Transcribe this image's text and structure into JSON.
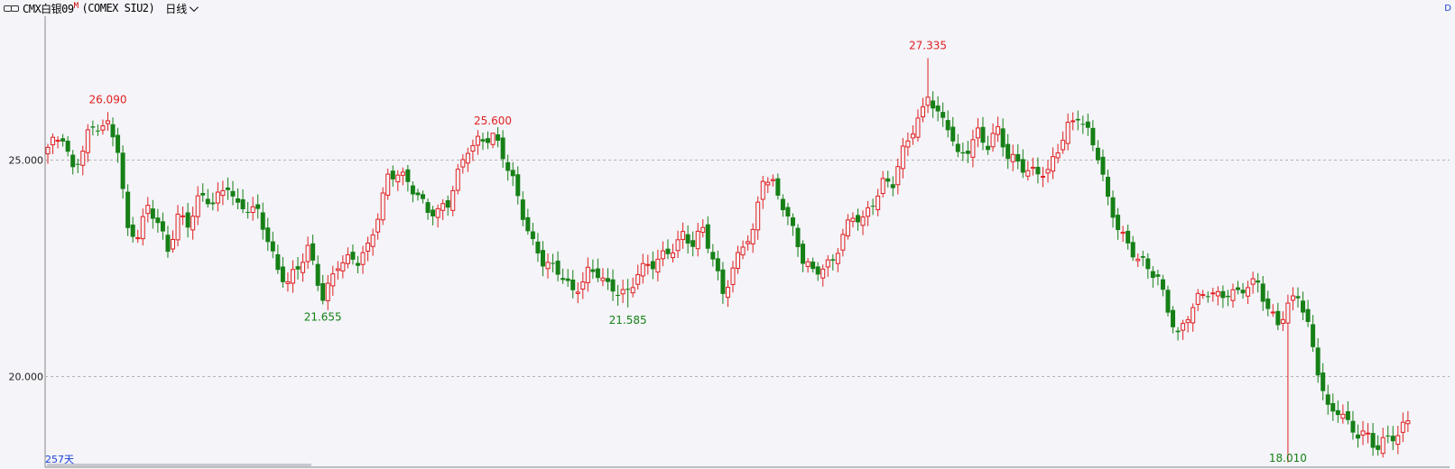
{
  "header": {
    "title": "CMX白银09",
    "title_sup": "M",
    "subtitle": "(COMEX SIU2)",
    "period": "日线",
    "right_mark": "D"
  },
  "footer": {
    "days": "257天"
  },
  "colors": {
    "up": "#e02020",
    "down": "#168016",
    "background": "#f4f4f9",
    "grid": "#bbbbbb"
  },
  "chart_data": {
    "type": "candlestick",
    "y_ticks": [
      {
        "value": 25,
        "label": "25.000"
      },
      {
        "value": 20,
        "label": "20.000"
      }
    ],
    "ylim": [
      17.9,
      28.3
    ],
    "grid": "horizontal-dashed",
    "extremes": [
      {
        "label": "26.090",
        "value": 26.09,
        "kind": "high",
        "index": 12
      },
      {
        "label": "21.655",
        "value": 21.655,
        "kind": "low",
        "index": 55
      },
      {
        "label": "25.600",
        "value": 25.6,
        "kind": "high",
        "index": 89
      },
      {
        "label": "21.585",
        "value": 21.585,
        "kind": "low",
        "index": 116
      },
      {
        "label": "27.335",
        "value": 27.335,
        "kind": "high",
        "index": 176
      },
      {
        "label": "18.010",
        "value": 18.01,
        "kind": "low",
        "index": 248
      }
    ],
    "anchors": [
      [
        0,
        25.2
      ],
      [
        3,
        25.5
      ],
      [
        5,
        24.8
      ],
      [
        8,
        25.6
      ],
      [
        10,
        25.7
      ],
      [
        12,
        25.7
      ],
      [
        14,
        25.3
      ],
      [
        16,
        23.4
      ],
      [
        18,
        23.3
      ],
      [
        20,
        23.8
      ],
      [
        22,
        23.5
      ],
      [
        24,
        22.9
      ],
      [
        26,
        23.8
      ],
      [
        28,
        23.5
      ],
      [
        30,
        24.0
      ],
      [
        33,
        24.0
      ],
      [
        36,
        24.5
      ],
      [
        38,
        23.9
      ],
      [
        40,
        23.8
      ],
      [
        42,
        23.7
      ],
      [
        44,
        23.2
      ],
      [
        46,
        22.5
      ],
      [
        48,
        22.2
      ],
      [
        50,
        22.4
      ],
      [
        52,
        22.9
      ],
      [
        54,
        22.2
      ],
      [
        55,
        21.9
      ],
      [
        58,
        22.6
      ],
      [
        62,
        22.6
      ],
      [
        64,
        23.0
      ],
      [
        66,
        23.8
      ],
      [
        68,
        24.6
      ],
      [
        70,
        24.6
      ],
      [
        72,
        24.4
      ],
      [
        74,
        24.2
      ],
      [
        76,
        23.9
      ],
      [
        78,
        23.8
      ],
      [
        80,
        23.9
      ],
      [
        82,
        24.6
      ],
      [
        84,
        25.3
      ],
      [
        86,
        25.5
      ],
      [
        89,
        25.5
      ],
      [
        91,
        25.0
      ],
      [
        93,
        24.5
      ],
      [
        95,
        23.8
      ],
      [
        97,
        23.1
      ],
      [
        99,
        22.6
      ],
      [
        101,
        22.4
      ],
      [
        103,
        22.3
      ],
      [
        105,
        22.0
      ],
      [
        108,
        22.4
      ],
      [
        110,
        22.3
      ],
      [
        112,
        22.0
      ],
      [
        116,
        22.0
      ],
      [
        118,
        22.4
      ],
      [
        121,
        22.5
      ],
      [
        124,
        22.9
      ],
      [
        127,
        23.3
      ],
      [
        129,
        23.0
      ],
      [
        131,
        23.3
      ],
      [
        133,
        22.7
      ],
      [
        135,
        22.0
      ],
      [
        137,
        22.5
      ],
      [
        139,
        23.0
      ],
      [
        141,
        23.2
      ],
      [
        143,
        24.6
      ],
      [
        145,
        24.5
      ],
      [
        147,
        24.0
      ],
      [
        149,
        23.3
      ],
      [
        151,
        22.6
      ],
      [
        153,
        22.4
      ],
      [
        155,
        22.6
      ],
      [
        157,
        22.7
      ],
      [
        159,
        23.2
      ],
      [
        161,
        23.6
      ],
      [
        163,
        23.6
      ],
      [
        165,
        24.1
      ],
      [
        167,
        24.5
      ],
      [
        169,
        24.4
      ],
      [
        171,
        25.1
      ],
      [
        173,
        25.7
      ],
      [
        175,
        26.2
      ],
      [
        176,
        26.6
      ],
      [
        178,
        26.0
      ],
      [
        180,
        25.7
      ],
      [
        182,
        25.0
      ],
      [
        184,
        25.3
      ],
      [
        186,
        25.7
      ],
      [
        188,
        25.3
      ],
      [
        190,
        25.6
      ],
      [
        192,
        25.0
      ],
      [
        194,
        25.0
      ],
      [
        196,
        24.8
      ],
      [
        198,
        24.7
      ],
      [
        200,
        24.6
      ],
      [
        202,
        25.2
      ],
      [
        204,
        25.8
      ],
      [
        206,
        26.1
      ],
      [
        208,
        25.6
      ],
      [
        210,
        25.0
      ],
      [
        212,
        24.0
      ],
      [
        214,
        23.5
      ],
      [
        216,
        23.1
      ],
      [
        218,
        22.7
      ],
      [
        220,
        22.4
      ],
      [
        222,
        22.2
      ],
      [
        224,
        21.6
      ],
      [
        226,
        21.0
      ],
      [
        228,
        21.4
      ],
      [
        230,
        21.7
      ],
      [
        232,
        21.9
      ],
      [
        234,
        21.9
      ],
      [
        236,
        22.0
      ],
      [
        238,
        21.9
      ],
      [
        240,
        22.0
      ],
      [
        242,
        22.1
      ],
      [
        244,
        21.6
      ],
      [
        246,
        21.3
      ],
      [
        248,
        21.6
      ],
      [
        250,
        21.8
      ],
      [
        252,
        21.1
      ],
      [
        254,
        20.2
      ],
      [
        256,
        19.3
      ],
      [
        258,
        19.2
      ],
      [
        260,
        18.8
      ],
      [
        262,
        18.6
      ],
      [
        264,
        18.7
      ],
      [
        266,
        18.4
      ],
      [
        268,
        18.6
      ],
      [
        270,
        18.5
      ],
      [
        272,
        19.0
      ]
    ],
    "data_labels": [
      "26.090",
      "21.655",
      "25.600",
      "21.585",
      "27.335",
      "18.010"
    ]
  }
}
